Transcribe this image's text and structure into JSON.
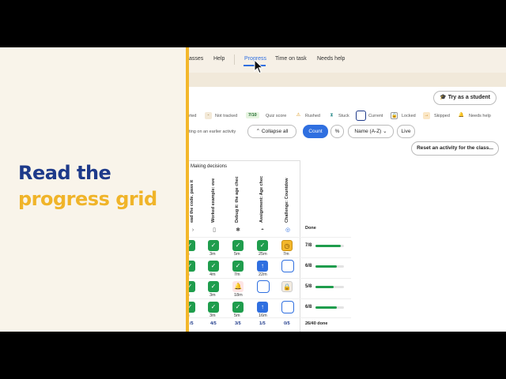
{
  "slide": {
    "title_line1": "Read the",
    "title_line2": "progress grid"
  },
  "nav": {
    "classes": "asses",
    "help": "Help",
    "progress": "Progress",
    "time_on_task": "Time on task",
    "needs_help": "Needs help"
  },
  "toolbar": {
    "try_as_student": "Try as a student"
  },
  "legend": {
    "started": "rted",
    "not_tracked": "Not tracked",
    "quiz_score_badge": "7/10",
    "quiz_score": "Quiz score",
    "rushed": "Rushed",
    "stuck": "Stuck",
    "current": "Current",
    "locked": "Locked",
    "skipped": "Skipped",
    "needs_help": "Needs help"
  },
  "controls": {
    "earlier_activity": "ting on an earlier activity",
    "collapse_all": "Collapse all",
    "count": "Count",
    "percent": "%",
    "sort": "Name (A-Z)",
    "live": "Live",
    "reset": "Reset an activity for the class..."
  },
  "grid": {
    "group_label": "Making decisions",
    "columns": [
      {
        "label": "ead the code. pass it",
        "icon": "›"
      },
      {
        "label": "Worked example: eve",
        "icon": "▯"
      },
      {
        "label": "Debug it: the age chec",
        "icon": "✱"
      },
      {
        "label": "Assignment: Age chec",
        "icon": "◓"
      },
      {
        "label": "Challenge: Countdow",
        "icon": "◎"
      }
    ],
    "done_label": "Done",
    "rows": [
      {
        "cells": [
          [
            "green",
            "m"
          ],
          [
            "green",
            "3m"
          ],
          [
            "green",
            "5m"
          ],
          [
            "green",
            "25m"
          ],
          [
            "yellow",
            "7m"
          ]
        ],
        "score": "7/8",
        "progress": 0.875
      },
      {
        "cells": [
          [
            "green",
            "m"
          ],
          [
            "green",
            "4m"
          ],
          [
            "green",
            "7m"
          ],
          [
            "blue",
            "22m"
          ],
          [
            "empty",
            ""
          ]
        ],
        "score": "6/8",
        "progress": 0.75
      },
      {
        "cells": [
          [
            "green",
            "m"
          ],
          [
            "green",
            "3m"
          ],
          [
            "stuck",
            "18m"
          ],
          [
            "empty",
            ""
          ],
          [
            "locked",
            ""
          ]
        ],
        "score": "5/8",
        "progress": 0.625
      },
      {
        "cells": [
          [
            "green",
            "m"
          ],
          [
            "green",
            "3m"
          ],
          [
            "green",
            "5m"
          ],
          [
            "blue",
            "16m"
          ],
          [
            "empty",
            ""
          ]
        ],
        "score": "6/8",
        "progress": 0.75
      }
    ],
    "summary": [
      "/5",
      "4/5",
      "3/5",
      "1/5",
      "0/5"
    ],
    "total": "26/40 done"
  },
  "colors": {
    "accent_blue": "#2f6fe0",
    "green": "#1f9d4d",
    "yellow": "#f3b72b",
    "navy": "#1e3a8a"
  }
}
